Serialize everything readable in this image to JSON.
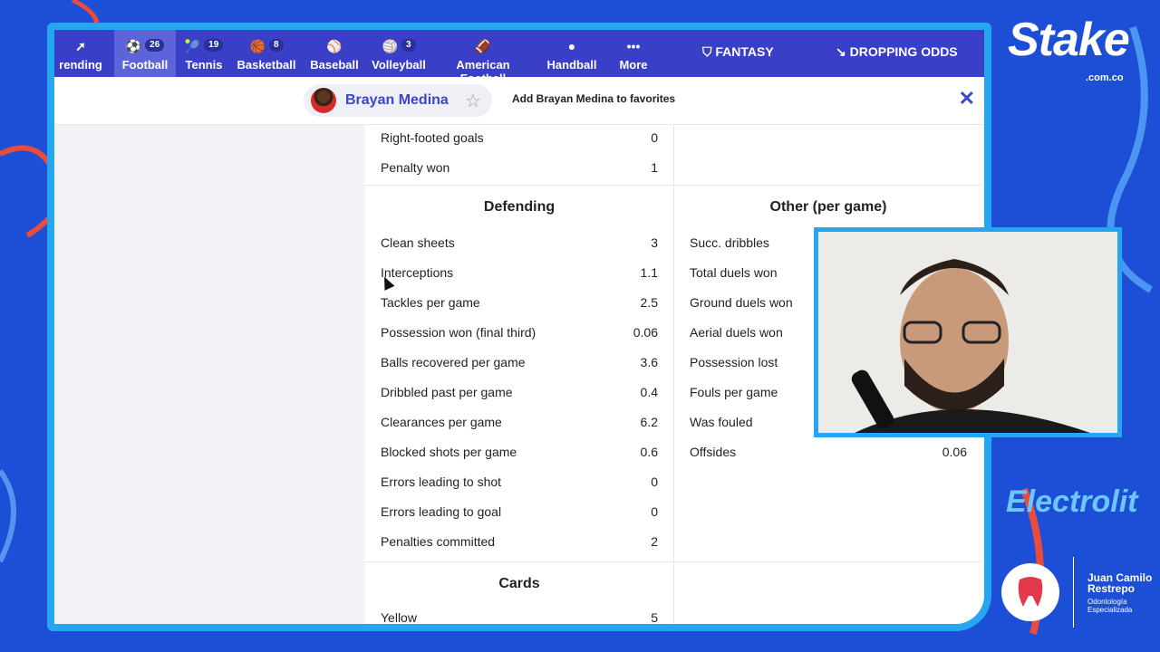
{
  "nav": {
    "items": [
      {
        "label": "rending",
        "icon": "trending-icon",
        "count": ""
      },
      {
        "label": "Football",
        "icon": "football-icon",
        "count": "26"
      },
      {
        "label": "Tennis",
        "icon": "tennis-icon",
        "count": "19"
      },
      {
        "label": "Basketball",
        "icon": "basketball-icon",
        "count": "8"
      },
      {
        "label": "Baseball",
        "icon": "baseball-icon",
        "count": ""
      },
      {
        "label": "Volleyball",
        "icon": "volleyball-icon",
        "count": "3"
      },
      {
        "label": "American Football",
        "icon": "american-football-icon",
        "count": ""
      },
      {
        "label": "Handball",
        "icon": "handball-icon",
        "count": ""
      },
      {
        "label": "More",
        "icon": "more-icon",
        "count": ""
      }
    ],
    "fantasy": "FANTASY",
    "dropping_odds": "DROPPING ODDS"
  },
  "favorite": {
    "player_name": "Brayan Medina",
    "add_text": "Add Brayan Medina to favorites"
  },
  "attacking_tail": [
    {
      "k": "Right-footed goals",
      "v": "0"
    },
    {
      "k": "Penalty won",
      "v": "1"
    }
  ],
  "defending": {
    "title": "Defending",
    "rows": [
      {
        "k": "Clean sheets",
        "v": "3"
      },
      {
        "k": "Interceptions",
        "v": "1.1"
      },
      {
        "k": "Tackles per game",
        "v": "2.5"
      },
      {
        "k": "Possession won (final third)",
        "v": "0.06"
      },
      {
        "k": "Balls recovered per game",
        "v": "3.6"
      },
      {
        "k": "Dribbled past per game",
        "v": "0.4"
      },
      {
        "k": "Clearances per game",
        "v": "6.2"
      },
      {
        "k": "Blocked shots per game",
        "v": "0.6"
      },
      {
        "k": "Errors leading to shot",
        "v": "0"
      },
      {
        "k": "Errors leading to goal",
        "v": "0"
      },
      {
        "k": "Penalties committed",
        "v": "2"
      }
    ]
  },
  "other": {
    "title": "Other (per game)",
    "rows": [
      {
        "k": "Succ. dribbles",
        "v": ""
      },
      {
        "k": "Total duels won",
        "v": ""
      },
      {
        "k": "Ground duels won",
        "v": ""
      },
      {
        "k": "Aerial duels won",
        "v": ""
      },
      {
        "k": "Possession lost",
        "v": ""
      },
      {
        "k": "Fouls per game",
        "v": ""
      },
      {
        "k": "Was fouled",
        "v": ""
      },
      {
        "k": "Offsides",
        "v": "0.06"
      }
    ]
  },
  "cards": {
    "title": "Cards",
    "rows": [
      {
        "k": "Yellow",
        "v": "5"
      }
    ]
  },
  "brand": {
    "stake": "Stake",
    "stake_sub": ".com.co",
    "electrolit": "Electrolit",
    "sponsor_name": "Juan Camilo Restrepo",
    "sponsor_sub": "Odontología Especializada"
  },
  "colors": {
    "nav": "#3a3fc7",
    "accent": "#3d45c8",
    "frame": "#26a6f0",
    "background": "#1d4fd6"
  }
}
